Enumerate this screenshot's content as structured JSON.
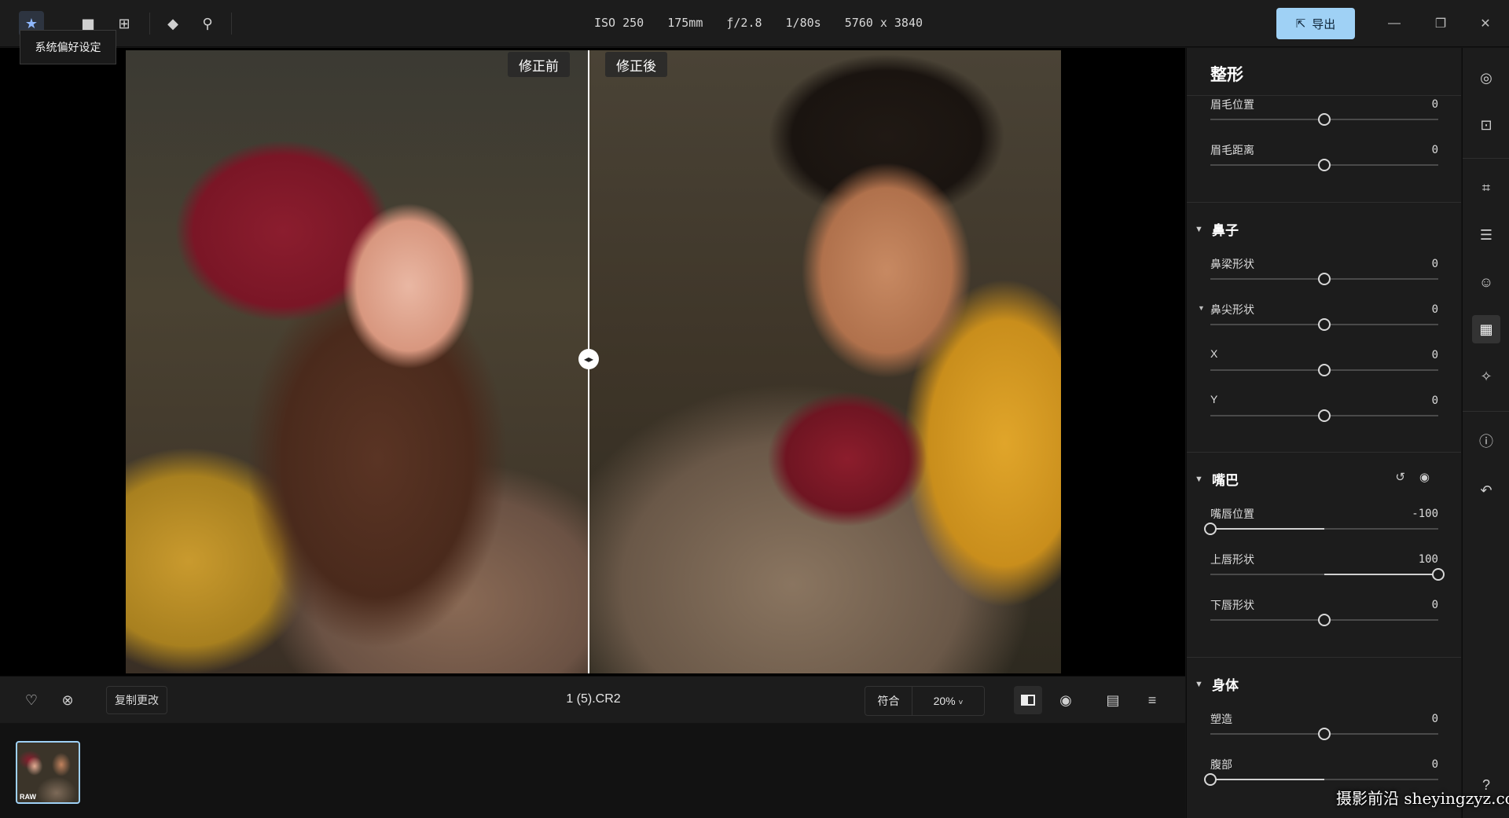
{
  "topbar": {
    "tooltip": "系统偏好设定",
    "exif": [
      "ISO 250",
      "175mm",
      "ƒ/2.8",
      "1/80s",
      "5760 x 3840"
    ],
    "export_label": "导出"
  },
  "viewer": {
    "before_label": "修正前",
    "after_label": "修正後"
  },
  "bottombar": {
    "copy_label": "复制更改",
    "filename": "1 (5).CR2",
    "fit_label": "符合",
    "zoom": "20%"
  },
  "filmstrip": {
    "thumb_badge": "RAW"
  },
  "panel": {
    "title": "整形",
    "eyebrows": [
      {
        "label": "眉毛位置",
        "value": "0",
        "level": 0.5
      },
      {
        "label": "眉毛距离",
        "value": "0",
        "level": 0.5
      }
    ],
    "nose": {
      "title": "鼻子",
      "sliders": [
        {
          "label": "鼻梁形状",
          "value": "0",
          "level": 0.5
        },
        {
          "label": "鼻尖形状",
          "value": "0",
          "level": 0.5
        },
        {
          "label": "X",
          "value": "0",
          "level": 0.5
        },
        {
          "label": "Y",
          "value": "0",
          "level": 0.5
        }
      ]
    },
    "mouth": {
      "title": "嘴巴",
      "sliders": [
        {
          "label": "嘴唇位置",
          "value": "-100",
          "level": 0.0
        },
        {
          "label": "上唇形状",
          "value": "100",
          "level": 1.0
        },
        {
          "label": "下唇形状",
          "value": "0",
          "level": 0.5
        }
      ]
    },
    "body": {
      "title": "身体",
      "sliders": [
        {
          "label": "塑造",
          "value": "0",
          "level": 0.5
        },
        {
          "label": "腹部",
          "value": "0",
          "level": 0.0
        }
      ]
    }
  },
  "watermark": "摄影前沿 sheyingzyz.com"
}
